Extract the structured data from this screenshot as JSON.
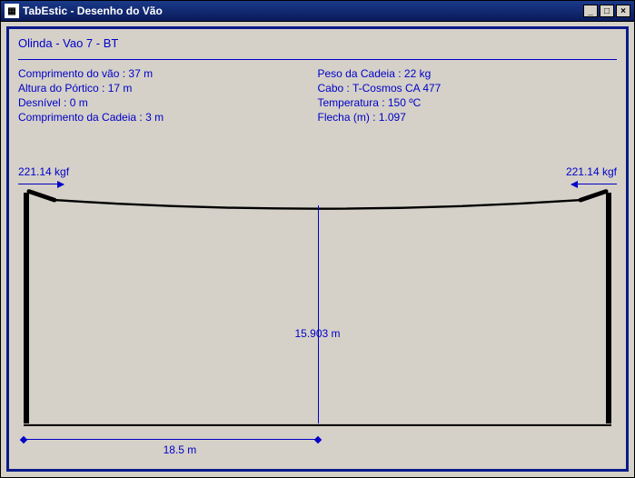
{
  "window": {
    "title": "TabEstic - Desenho do Vão"
  },
  "header": {
    "title": "Olinda - Vao 7 - BT"
  },
  "left_col": {
    "span_len": "Comprimento do vão : 37 m",
    "gantry_h": "Altura do Pórtico : 17 m",
    "unevenness": "Desnível : 0 m",
    "chain_len": "Comprimento da Cadeia : 3 m"
  },
  "right_col": {
    "chain_w": "Peso da Cadeia : 22 kg",
    "cable": "Cabo : T-Cosmos CA 477",
    "temp": "Temperatura : 150 ºC",
    "sag": "Flecha (m) : 1.097"
  },
  "diagram": {
    "force_left": "221.14 kgf",
    "force_right": "221.14 kgf",
    "v_mid": "15.903 m",
    "h_half": "18.5 m"
  }
}
